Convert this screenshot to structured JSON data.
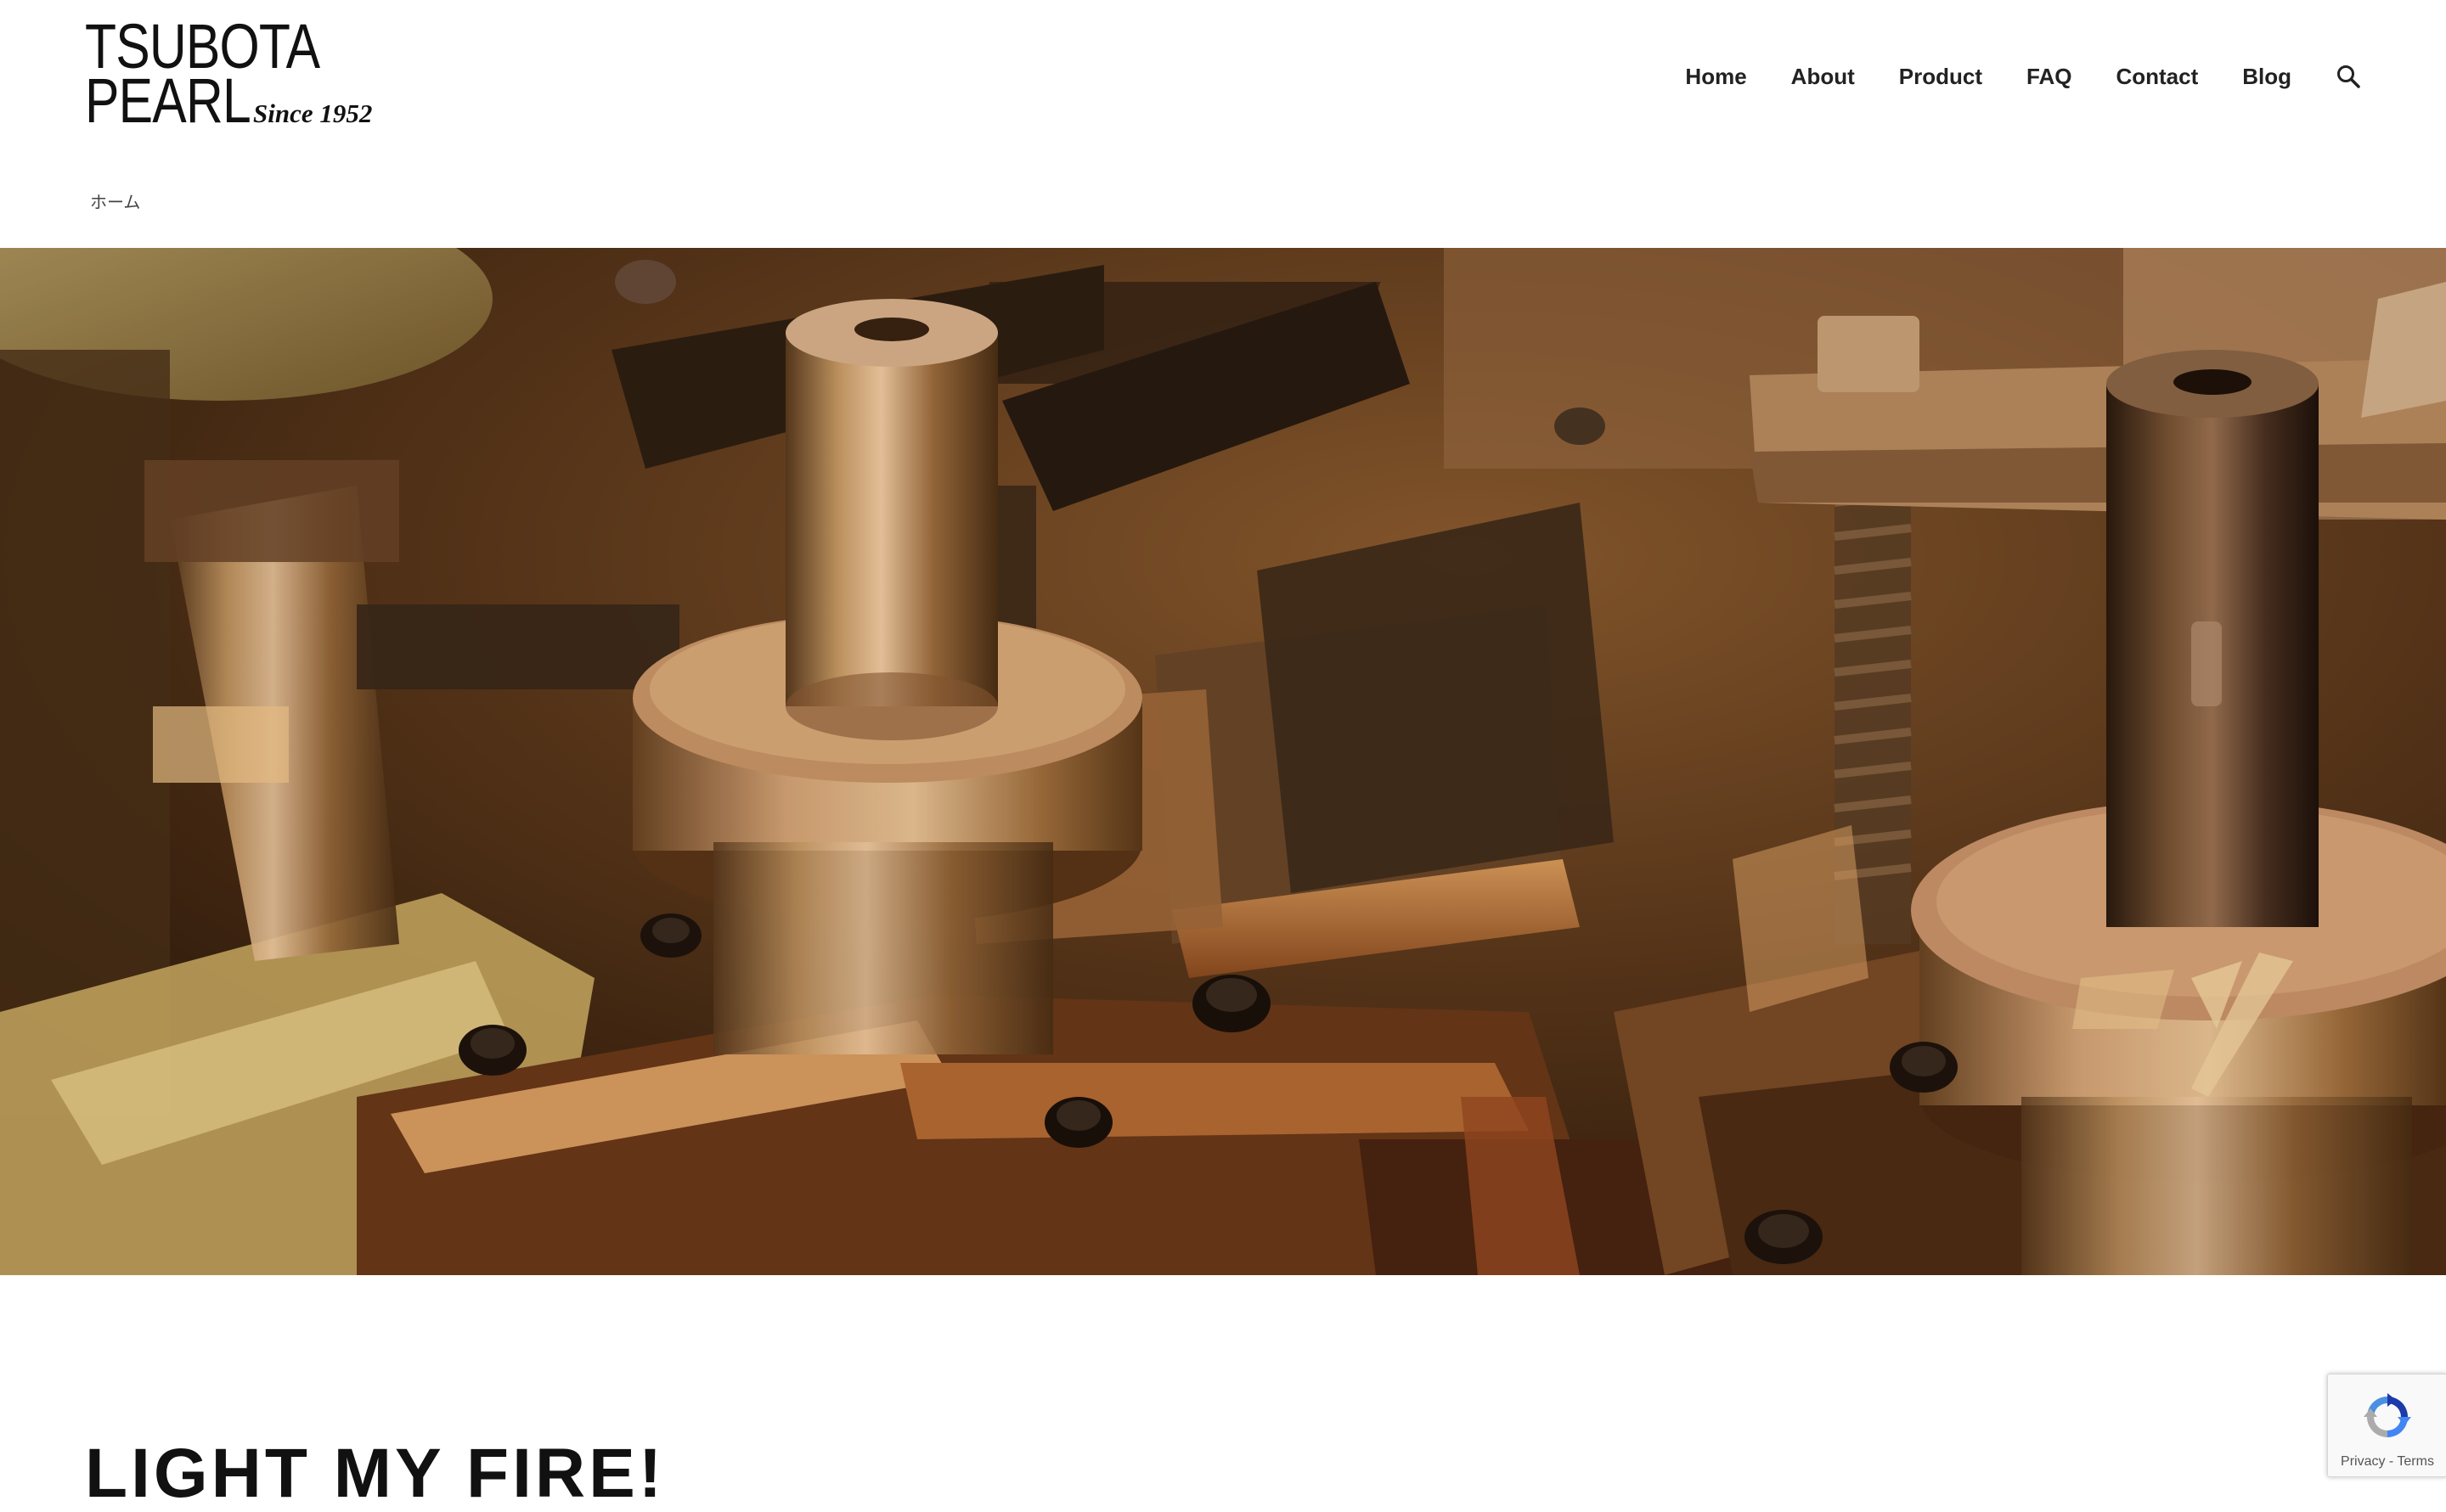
{
  "logo": {
    "line1": "TSUBOTA",
    "line2": "PEARL",
    "since": "Since 1952"
  },
  "nav": {
    "items": [
      {
        "label": "Home"
      },
      {
        "label": "About"
      },
      {
        "label": "Product"
      },
      {
        "label": "FAQ"
      },
      {
        "label": "Contact"
      },
      {
        "label": "Blog"
      }
    ],
    "search_icon": "search-icon"
  },
  "breadcrumb": {
    "home": "ホーム"
  },
  "hero": {
    "image": "close-up of brass and steel machine parts with cylindrical posts and bolts"
  },
  "page": {
    "title": "LIGHT MY FIRE!"
  },
  "recaptcha": {
    "privacy": "Privacy",
    "separator": " - ",
    "terms": "Terms"
  },
  "colors": {
    "text": "#111111",
    "nav_text": "#222222",
    "background": "#ffffff",
    "hero_dark": "#3a2412",
    "hero_brass": "#b07a3e",
    "recaptcha_blue": "#4a90e2"
  }
}
